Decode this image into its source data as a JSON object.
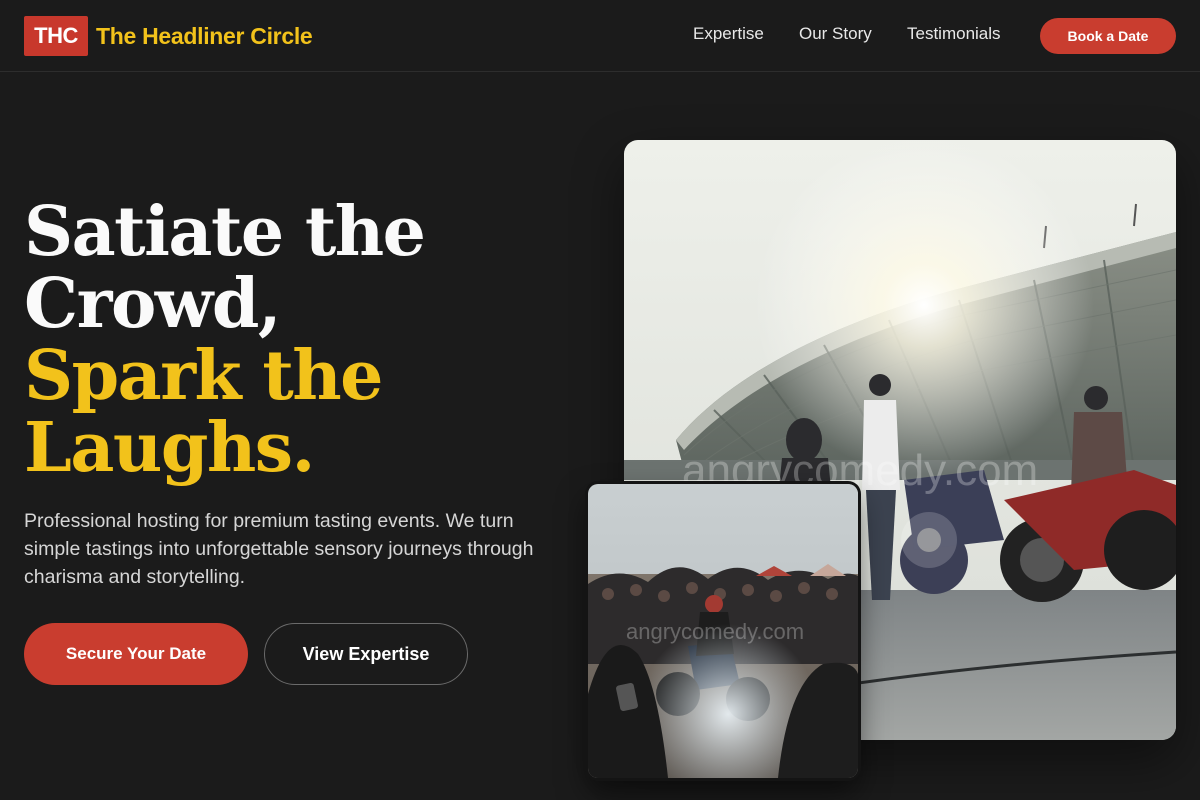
{
  "brand": {
    "badge": "THC",
    "name": "The Headliner Circle",
    "accent": "#f2c21b",
    "primary": "#c93d2f"
  },
  "nav": {
    "links": [
      "Expertise",
      "Our Story",
      "Testimonials"
    ],
    "cta": "Book a Date"
  },
  "hero": {
    "title_lines": [
      "Satiate the",
      "Crowd,"
    ],
    "highlight_lines": [
      "Spark the",
      "Laughs."
    ],
    "description": "Professional hosting for premium tasting events. We turn simple tastings into unforgettable sensory journeys through charisma and storytelling.",
    "primary_button": "Secure Your Date",
    "secondary_button": "View Expertise"
  },
  "images": {
    "main_watermark": "angrycomedy.com",
    "small_watermark": "angrycomedy.com"
  }
}
